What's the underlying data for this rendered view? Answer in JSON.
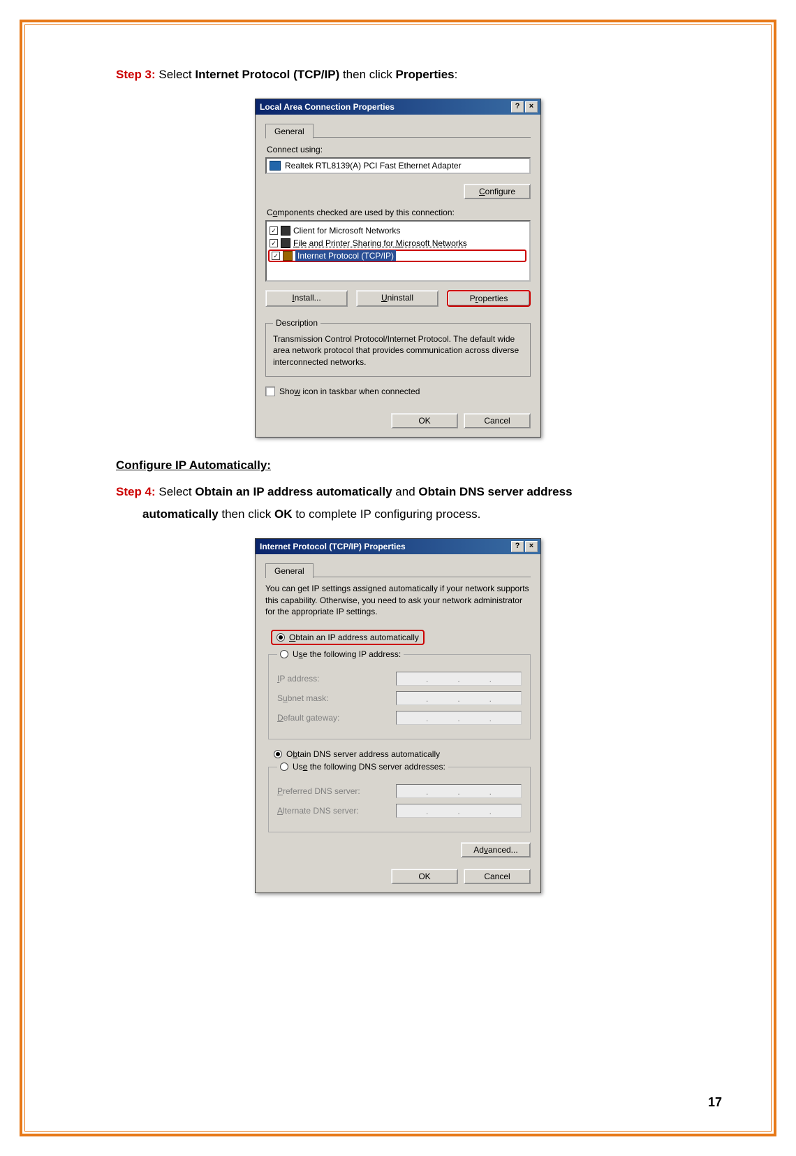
{
  "step3": {
    "label": "Step 3:",
    "prefix": " Select ",
    "bold1": "Internet Protocol (TCP/IP)",
    "mid": " then click ",
    "bold2": "Properties",
    "suffix": ":"
  },
  "section_heading": "Configure IP Automatically:",
  "step4": {
    "label": "Step 4:",
    "prefix": " Select ",
    "bold1": "Obtain an IP address automatically",
    "mid": " and ",
    "bold2": "Obtain DNS server address",
    "bold3": "automatically",
    "then": " then click ",
    "bold4": "OK",
    "suffix": " to complete IP configuring process."
  },
  "dialog1": {
    "title": "Local Area Connection Properties",
    "help": "?",
    "close": "×",
    "tab": "General",
    "connect_using": "Connect using:",
    "nic": "Realtek RTL8139(A) PCI Fast Ethernet Adapter",
    "configure": "Configure",
    "components_label": "Components checked are used by this connection:",
    "items": [
      {
        "label": "Client for Microsoft Networks"
      },
      {
        "label": "File and Printer Sharing for Microsoft Networks"
      },
      {
        "label": "Internet Protocol (TCP/IP)"
      }
    ],
    "install": "Install...",
    "uninstall": "Uninstall",
    "properties": "Properties",
    "desc_legend": "Description",
    "desc_text": "Transmission Control Protocol/Internet Protocol. The default wide area network protocol that provides communication across diverse interconnected networks.",
    "show_icon": "Show icon in taskbar when connected",
    "ok": "OK",
    "cancel": "Cancel"
  },
  "dialog2": {
    "title": "Internet Protocol (TCP/IP) Properties",
    "help": "?",
    "close": "×",
    "tab": "General",
    "info": "You can get IP settings assigned automatically if your network supports this capability. Otherwise, you need to ask your network administrator for the appropriate IP settings.",
    "r_obtain_ip": "Obtain an IP address automatically",
    "r_use_ip": "Use the following IP address:",
    "ip_address": "IP address:",
    "subnet": "Subnet mask:",
    "gateway": "Default gateway:",
    "r_obtain_dns": "Obtain DNS server address automatically",
    "r_use_dns": "Use the following DNS server addresses:",
    "pref_dns": "Preferred DNS server:",
    "alt_dns": "Alternate DNS server:",
    "advanced": "Advanced...",
    "ok": "OK",
    "cancel": "Cancel"
  },
  "page_number": "17"
}
